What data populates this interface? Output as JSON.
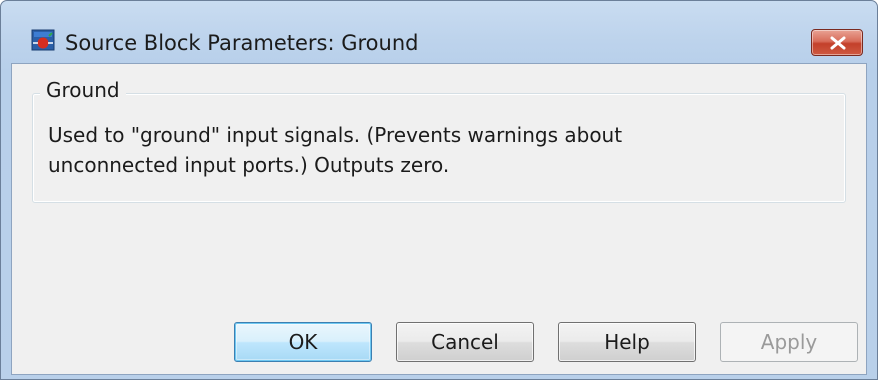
{
  "window": {
    "title": "Source Block Parameters: Ground",
    "icon": "simulink-block-icon",
    "close_icon": "close-x-icon"
  },
  "group": {
    "legend": "Ground",
    "description_line1": "Used to \"ground\" input signals.  (Prevents warnings about",
    "description_line2": "unconnected input ports.)  Outputs zero."
  },
  "buttons": {
    "ok": "OK",
    "cancel": "Cancel",
    "help": "Help",
    "apply": "Apply"
  },
  "states": {
    "apply_enabled": false,
    "default_button": "OK"
  },
  "colors": {
    "close_button": "#c3402a",
    "default_button_border": "#3c7fb1",
    "disabled_text": "#9a9a9a"
  }
}
